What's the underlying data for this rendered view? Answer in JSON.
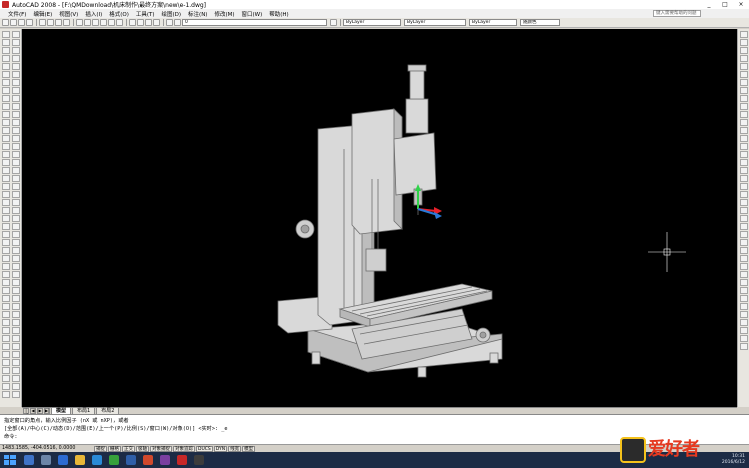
{
  "window": {
    "title": "AutoCAD 2008 - [F:\\QMDownload\\机床制作\\最终方案\\new\\e-1.dwg]",
    "controls": [
      "_",
      "□",
      "×"
    ]
  },
  "menu": {
    "items": [
      "文件(F)",
      "编辑(E)",
      "视图(V)",
      "插入(I)",
      "格式(O)",
      "工具(T)",
      "绘图(D)",
      "标注(N)",
      "修改(M)",
      "窗口(W)",
      "帮助(H)"
    ],
    "help_search": "键入需要帮助的问题"
  },
  "toolbar": {
    "layer_value": "0",
    "color_value": "ByLayer",
    "linetype_value": "ByLayer",
    "lineweight_value": "ByLayer",
    "plotstyle_value": "随颜色"
  },
  "tabs": {
    "items": [
      "模型",
      "布局1",
      "布局2"
    ],
    "active": 0
  },
  "command": {
    "line1": "指定窗口的角点，输入比例因子 (nX 或 nXP)，或者",
    "line2": "[全部(A)/中心(C)/动态(D)/范围(E)/上一个(P)/比例(S)/窗口(W)/对象(O)] <实时>: _e",
    "line3": "命令:"
  },
  "status": {
    "coords": "1483.1585, -404.0516, 0.0000",
    "toggles": [
      "捕捉",
      "栅格",
      "正交",
      "极轴",
      "对象捕捉",
      "对象追踪",
      "DUCS",
      "DYN",
      "线宽",
      "模型"
    ]
  },
  "taskbar": {
    "time": "10:31",
    "date": "2016/6/12"
  },
  "watermark": {
    "text": "爱好者"
  },
  "colors": {
    "canvas": "#000000",
    "model_face": "#d9d9d9",
    "model_line": "#6e6e6e",
    "gizmo_red": "#e8202a",
    "gizmo_green": "#2fd34a",
    "gizmo_blue": "#2a7ad8"
  }
}
